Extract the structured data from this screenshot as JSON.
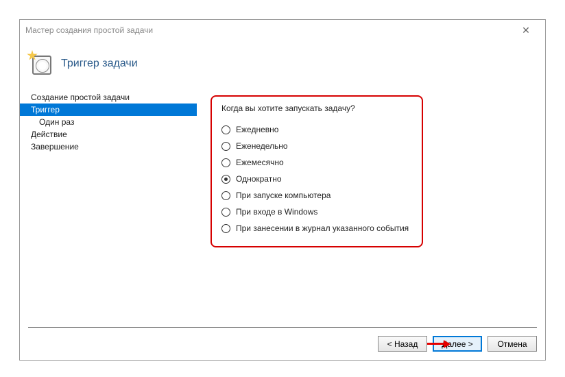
{
  "window": {
    "title": "Мастер создания простой задачи"
  },
  "header": {
    "title": "Триггер задачи"
  },
  "sidebar": {
    "items": [
      {
        "label": "Создание простой задачи",
        "selected": false,
        "sub": false
      },
      {
        "label": "Триггер",
        "selected": true,
        "sub": false
      },
      {
        "label": "Один раз",
        "selected": false,
        "sub": true
      },
      {
        "label": "Действие",
        "selected": false,
        "sub": false
      },
      {
        "label": "Завершение",
        "selected": false,
        "sub": false
      }
    ]
  },
  "main": {
    "question": "Когда вы хотите запускать задачу?",
    "options": [
      {
        "label": "Ежедневно",
        "checked": false
      },
      {
        "label": "Еженедельно",
        "checked": false
      },
      {
        "label": "Ежемесячно",
        "checked": false
      },
      {
        "label": "Однократно",
        "checked": true
      },
      {
        "label": "При запуске компьютера",
        "checked": false
      },
      {
        "label": "При входе в Windows",
        "checked": false
      },
      {
        "label": "При занесении в журнал указанного события",
        "checked": false
      }
    ]
  },
  "footer": {
    "back": "< Назад",
    "next": "Далее >",
    "cancel": "Отмена"
  }
}
